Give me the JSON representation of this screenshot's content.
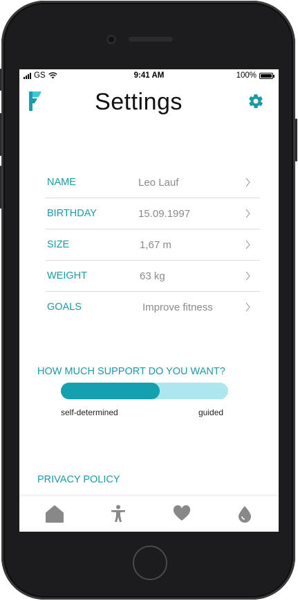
{
  "status_bar": {
    "carrier": "GS",
    "time": "9:41 AM",
    "battery": "100%"
  },
  "header": {
    "title": "Settings",
    "logo_icon": "app-logo-icon",
    "settings_icon": "gear-icon"
  },
  "profile": {
    "rows": [
      {
        "label": "NAME",
        "value": "Leo Lauf"
      },
      {
        "label": "BIRTHDAY",
        "value": "15.09.1997"
      },
      {
        "label": "SIZE",
        "value": "1,67 m"
      },
      {
        "label": "WEIGHT",
        "value": "63 kg"
      },
      {
        "label": "GOALS",
        "value": "Improve fitness"
      }
    ]
  },
  "support": {
    "title": "HOW MUCH SUPPORT DO YOU WANT?",
    "level_fraction": 0.59,
    "min_label": "self-determined",
    "max_label": "guided"
  },
  "privacy_label": "PRIVACY POLICY",
  "tab_bar": {
    "icons": [
      "home-icon",
      "person-icon",
      "heart-icon",
      "drop-icon"
    ]
  },
  "colors": {
    "accent": "#1a9aa6",
    "slider_fill": "#14a0ae",
    "slider_track": "#aee6f0",
    "tab_icon": "#888888"
  }
}
